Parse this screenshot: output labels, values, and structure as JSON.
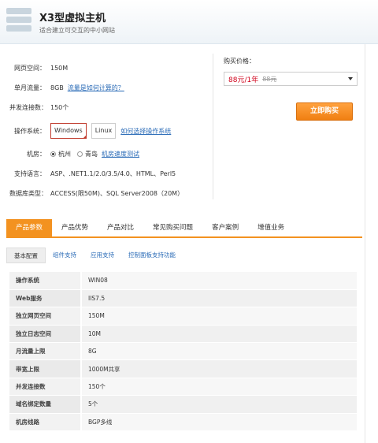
{
  "header": {
    "title": "X3型虚拟主机",
    "subtitle": "适合建立可交互的中小网站"
  },
  "specs": {
    "space": {
      "label": "网页空间：",
      "value": "150M"
    },
    "traffic": {
      "label": "单月流量：",
      "value": "8GB",
      "link": "流量是如何计算的？"
    },
    "connections": {
      "label": "并发连接数：",
      "value": "150个"
    },
    "os": {
      "label": "操作系统：",
      "options": [
        "Windows",
        "Linux"
      ],
      "selected": "Windows",
      "link": "如何选择操作系统"
    },
    "room": {
      "label": "机房：",
      "options": [
        "杭州",
        "青岛"
      ],
      "selected": "杭州",
      "link": "机房速度测试"
    },
    "lang": {
      "label": "支持语言：",
      "value": "ASP、.NET1.1/2.0/3.5/4.0、HTML、Perl5"
    },
    "db": {
      "label": "数据库类型：",
      "value": "ACCESS(限50M)、SQL Server2008（20M）"
    }
  },
  "buy": {
    "title": "购买价格：",
    "price": "88元/1年",
    "old_price": "88元",
    "button": "立即购买"
  },
  "tabs": [
    "产品参数",
    "产品优势",
    "产品对比",
    "常见购买问题",
    "客户案例",
    "增值业务"
  ],
  "active_tab": "产品参数",
  "subtabs": [
    "基本配置",
    "组件支持",
    "应用支持",
    "控制面板支持功能"
  ],
  "active_subtab": "基本配置",
  "table": [
    {
      "k": "操作系统",
      "v": "WIN08"
    },
    {
      "k": "Web服务",
      "v": "IIS7.5"
    },
    {
      "k": "独立网页空间",
      "v": "150M"
    },
    {
      "k": "独立日志空间",
      "v": "10M"
    },
    {
      "k": "月流量上限",
      "v": "8G"
    },
    {
      "k": "带宽上限",
      "v": "1000M共享"
    },
    {
      "k": "并发连接数",
      "v": "150个"
    },
    {
      "k": "域名绑定数量",
      "v": "5个"
    },
    {
      "k": "机房线路",
      "v": "BGP多线"
    }
  ]
}
